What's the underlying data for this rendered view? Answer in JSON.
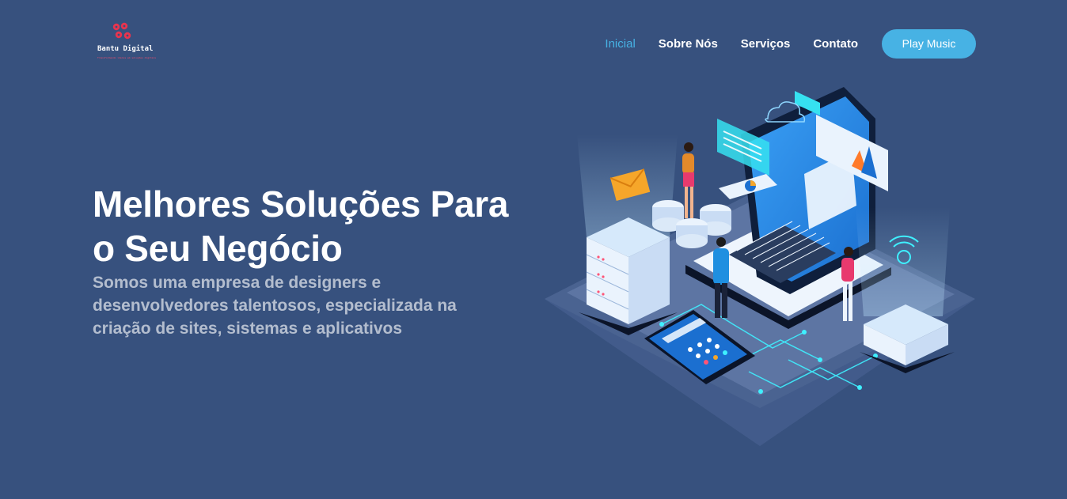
{
  "brand": {
    "name": "Bantu Digital",
    "tagline": "Transformando ideias em soluções digitais",
    "logo_icon": "logo-mark-icon",
    "accent_color": "#ff4d6d"
  },
  "nav": {
    "items": [
      {
        "label": "Inicial",
        "active": true
      },
      {
        "label": "Sobre Nós",
        "active": false
      },
      {
        "label": "Serviços",
        "active": false
      },
      {
        "label": "Contato",
        "active": false
      }
    ],
    "cta_label": "Play Music"
  },
  "hero": {
    "title": "Melhores Soluções Para o Seu Negócio",
    "subtitle": "Somos uma empresa de designers e desenvolvedores talentosos, especializada na criação de sites, sistemas e aplicativos",
    "illustration_icon": "isometric-tech-illustration-icon"
  },
  "colors": {
    "background": "#37517e",
    "accent": "#47b2e4",
    "text": "#ffffff"
  }
}
